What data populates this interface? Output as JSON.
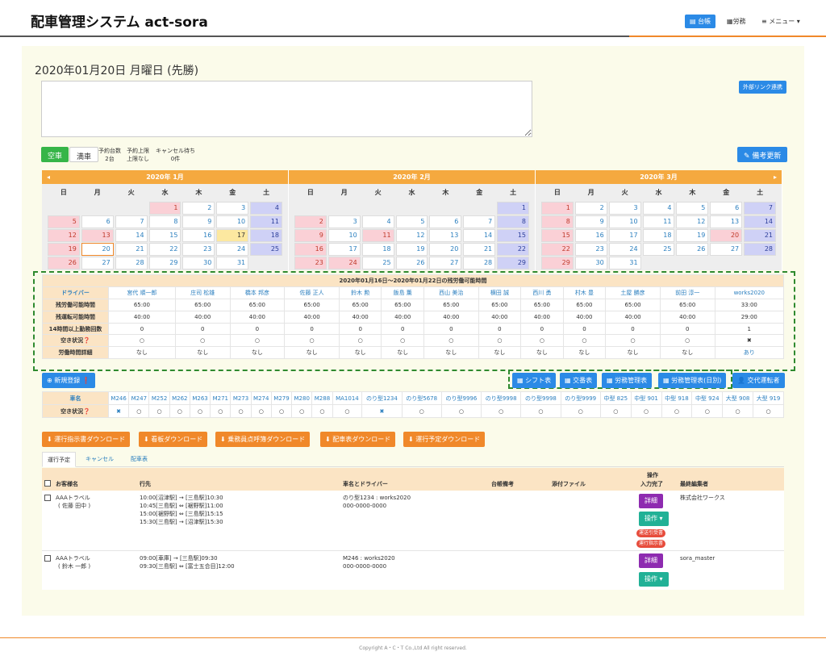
{
  "header": {
    "title": "配車管理システム act-sora",
    "nav": [
      "台帳",
      "労務",
      "≡ メニュー ▾"
    ]
  },
  "page": {
    "date_title": "2020年01月20日 月曜日 (先勝)",
    "external_link_btn": "外部リンク連携",
    "memo_value": ""
  },
  "status": {
    "empty_label": "空車",
    "full_label": "満車",
    "booking_count_label": "予約台数",
    "booking_count": "2台",
    "booking_limit_label": "予約上限",
    "booking_limit": "上限なし",
    "cancel_wait_label": "キャンセル待ち",
    "cancel_wait": "0件",
    "note_update_btn": "✎ 備考更新"
  },
  "calendar": {
    "weekdays": [
      "日",
      "月",
      "火",
      "水",
      "木",
      "金",
      "土"
    ],
    "months": [
      {
        "title": "2020年 1月",
        "weeks": [
          [
            {
              "d": ""
            },
            {
              "d": ""
            },
            {
              "d": ""
            },
            {
              "d": "1",
              "t": "hol"
            },
            {
              "d": "2"
            },
            {
              "d": "3"
            },
            {
              "d": "4",
              "t": "sat"
            }
          ],
          [
            {
              "d": "5",
              "t": "sun"
            },
            {
              "d": "6"
            },
            {
              "d": "7"
            },
            {
              "d": "8"
            },
            {
              "d": "9"
            },
            {
              "d": "10"
            },
            {
              "d": "11",
              "t": "sat"
            }
          ],
          [
            {
              "d": "12",
              "t": "sun"
            },
            {
              "d": "13",
              "t": "hol"
            },
            {
              "d": "14"
            },
            {
              "d": "15"
            },
            {
              "d": "16"
            },
            {
              "d": "17",
              "t": "yellow"
            },
            {
              "d": "18",
              "t": "sat"
            }
          ],
          [
            {
              "d": "19",
              "t": "sun"
            },
            {
              "d": "20",
              "t": "today"
            },
            {
              "d": "21"
            },
            {
              "d": "22"
            },
            {
              "d": "23"
            },
            {
              "d": "24"
            },
            {
              "d": "25",
              "t": "sat"
            }
          ],
          [
            {
              "d": "26",
              "t": "sun"
            },
            {
              "d": "27"
            },
            {
              "d": "28"
            },
            {
              "d": "29"
            },
            {
              "d": "30"
            },
            {
              "d": "31"
            },
            {
              "d": ""
            }
          ]
        ]
      },
      {
        "title": "2020年 2月",
        "weeks": [
          [
            {
              "d": ""
            },
            {
              "d": ""
            },
            {
              "d": ""
            },
            {
              "d": ""
            },
            {
              "d": ""
            },
            {
              "d": ""
            },
            {
              "d": "1",
              "t": "sat"
            }
          ],
          [
            {
              "d": "2",
              "t": "sun"
            },
            {
              "d": "3"
            },
            {
              "d": "4"
            },
            {
              "d": "5"
            },
            {
              "d": "6"
            },
            {
              "d": "7"
            },
            {
              "d": "8",
              "t": "sat"
            }
          ],
          [
            {
              "d": "9",
              "t": "sun"
            },
            {
              "d": "10"
            },
            {
              "d": "11",
              "t": "hol"
            },
            {
              "d": "12"
            },
            {
              "d": "13"
            },
            {
              "d": "14"
            },
            {
              "d": "15",
              "t": "sat"
            }
          ],
          [
            {
              "d": "16",
              "t": "sun"
            },
            {
              "d": "17"
            },
            {
              "d": "18"
            },
            {
              "d": "19"
            },
            {
              "d": "20"
            },
            {
              "d": "21"
            },
            {
              "d": "22",
              "t": "sat"
            }
          ],
          [
            {
              "d": "23",
              "t": "sun"
            },
            {
              "d": "24",
              "t": "hol"
            },
            {
              "d": "25"
            },
            {
              "d": "26"
            },
            {
              "d": "27"
            },
            {
              "d": "28"
            },
            {
              "d": "29",
              "t": "sat"
            }
          ]
        ]
      },
      {
        "title": "2020年 3月",
        "weeks": [
          [
            {
              "d": "1",
              "t": "sun"
            },
            {
              "d": "2"
            },
            {
              "d": "3"
            },
            {
              "d": "4"
            },
            {
              "d": "5"
            },
            {
              "d": "6"
            },
            {
              "d": "7",
              "t": "sat"
            }
          ],
          [
            {
              "d": "8",
              "t": "sun"
            },
            {
              "d": "9"
            },
            {
              "d": "10"
            },
            {
              "d": "11"
            },
            {
              "d": "12"
            },
            {
              "d": "13"
            },
            {
              "d": "14",
              "t": "sat"
            }
          ],
          [
            {
              "d": "15",
              "t": "sun"
            },
            {
              "d": "16"
            },
            {
              "d": "17"
            },
            {
              "d": "18"
            },
            {
              "d": "19"
            },
            {
              "d": "20",
              "t": "hol"
            },
            {
              "d": "21",
              "t": "sat"
            }
          ],
          [
            {
              "d": "22",
              "t": "sun"
            },
            {
              "d": "23"
            },
            {
              "d": "24"
            },
            {
              "d": "25"
            },
            {
              "d": "26"
            },
            {
              "d": "27"
            },
            {
              "d": "28",
              "t": "sat"
            }
          ],
          [
            {
              "d": "29",
              "t": "sun"
            },
            {
              "d": "30"
            },
            {
              "d": "31"
            },
            {
              "d": ""
            },
            {
              "d": ""
            },
            {
              "d": ""
            },
            {
              "d": ""
            }
          ]
        ]
      }
    ]
  },
  "labor": {
    "caption": "2020年01月16日～2020年01月22日の残労働可能時間",
    "row_labels": [
      "ドライバー",
      "残労働可能時間",
      "残運転可能時間",
      "14時間以上勤務回数",
      "空き状況❓",
      "労働時間詳細"
    ],
    "drivers": [
      {
        "name": "宮代 順一郎",
        "work": "65:00",
        "drive": "40:00",
        "count": "0",
        "avail": "○",
        "detail": "なし"
      },
      {
        "name": "庄司 松雄",
        "work": "65:00",
        "drive": "40:00",
        "count": "0",
        "avail": "○",
        "detail": "なし"
      },
      {
        "name": "橋本 邦彦",
        "work": "65:00",
        "drive": "40:00",
        "count": "0",
        "avail": "○",
        "detail": "なし"
      },
      {
        "name": "佐藤 正人",
        "work": "65:00",
        "drive": "40:00",
        "count": "0",
        "avail": "○",
        "detail": "なし"
      },
      {
        "name": "鈴木 勲",
        "work": "65:00",
        "drive": "40:00",
        "count": "0",
        "avail": "○",
        "detail": "なし"
      },
      {
        "name": "飯島 薫",
        "work": "65:00",
        "drive": "40:00",
        "count": "0",
        "avail": "○",
        "detail": "なし"
      },
      {
        "name": "西山 美治",
        "work": "65:00",
        "drive": "40:00",
        "count": "0",
        "avail": "○",
        "detail": "なし"
      },
      {
        "name": "横田 誠",
        "work": "65:00",
        "drive": "40:00",
        "count": "0",
        "avail": "○",
        "detail": "なし"
      },
      {
        "name": "西川 勇",
        "work": "65:00",
        "drive": "40:00",
        "count": "0",
        "avail": "○",
        "detail": "なし"
      },
      {
        "name": "村木 豊",
        "work": "65:00",
        "drive": "40:00",
        "count": "0",
        "avail": "○",
        "detail": "なし"
      },
      {
        "name": "土屋 勝彦",
        "work": "65:00",
        "drive": "40:00",
        "count": "0",
        "avail": "○",
        "detail": "なし"
      },
      {
        "name": "前田 淳一",
        "work": "65:00",
        "drive": "40:00",
        "count": "0",
        "avail": "○",
        "detail": "なし"
      },
      {
        "name": "works2020",
        "work": "33:00",
        "drive": "29:00",
        "count": "1",
        "avail": "✖",
        "detail": "あり"
      }
    ]
  },
  "toolbar": {
    "new_btn": "⊕ 新規登録 ❗",
    "shift_btn": "▦ シフト表",
    "relay_btn": "▦ 交番表",
    "labor_btn": "▦ 労務管理表",
    "labor_daily_btn": "▦ 労務管理表(日別)",
    "substitute_btn": "👤 交代運転者"
  },
  "vehicles": {
    "label_name": "車名",
    "label_avail": "空き状況❓",
    "items": [
      {
        "n": "M246",
        "a": "✖"
      },
      {
        "n": "M247",
        "a": "○"
      },
      {
        "n": "M252",
        "a": "○"
      },
      {
        "n": "M262",
        "a": "○"
      },
      {
        "n": "M263",
        "a": "○"
      },
      {
        "n": "M271",
        "a": "○"
      },
      {
        "n": "M273",
        "a": "○"
      },
      {
        "n": "M274",
        "a": "○"
      },
      {
        "n": "M279",
        "a": "○"
      },
      {
        "n": "M280",
        "a": "○"
      },
      {
        "n": "M288",
        "a": "○"
      },
      {
        "n": "MA1014",
        "a": "○"
      },
      {
        "n": "のり型1234",
        "a": "✖"
      },
      {
        "n": "のり型5678",
        "a": "○"
      },
      {
        "n": "のり型9996",
        "a": "○"
      },
      {
        "n": "のり型9998",
        "a": "○"
      },
      {
        "n": "のり型9998",
        "a": "○"
      },
      {
        "n": "のり型9999",
        "a": "○"
      },
      {
        "n": "中型 825",
        "a": "○"
      },
      {
        "n": "中型 901",
        "a": "○"
      },
      {
        "n": "中型 918",
        "a": "○"
      },
      {
        "n": "中型 924",
        "a": "○"
      },
      {
        "n": "大型 908",
        "a": "○"
      },
      {
        "n": "大型 919",
        "a": "○"
      }
    ]
  },
  "downloads": [
    "⬇ 運行指示書ダウンロード",
    "⬇ 看板ダウンロード",
    "⬇ 乗務員点呼簿ダウンロード",
    "⬇ 配車表ダウンロード",
    "⬇ 運行予定ダウンロード"
  ],
  "tabs": [
    "運行予定",
    "キャンセル",
    "配車表"
  ],
  "orders": {
    "headers": {
      "customer": "お客様名",
      "route": "行先",
      "vehicle_driver": "車名とドライバー",
      "ledger_note": "台帳備考",
      "attachment": "添付ファイル",
      "operation": "操作",
      "input_done": "入力完了",
      "last_editor": "最終編集者"
    },
    "rows": [
      {
        "customer": "AAAトラベル",
        "contact": "( 佐藤 田中 )",
        "route": [
          "10:00[沼津駅] → [三島駅]10:30",
          "10:45[三島駅] ⇔ [裾野駅]11:00",
          "15:00[裾野駅] ⇔ [三島駅]15:15",
          "15:30[三島駅] → [沼津駅]15:30"
        ],
        "vehicle": "のり型1234 : works2020",
        "phone": "000-0000-0000",
        "editor": "株式会社ワークス",
        "detail_btn": "詳細",
        "op_btn": "操作 ▾",
        "badges": [
          "運送引受書",
          "運行指示書"
        ]
      },
      {
        "customer": "AAAトラベル",
        "contact": "( 鈴木 一郎 )",
        "route": [
          "09:00[車庫] → [三島駅]09:30",
          "09:30[三島駅] ⇔ [富士五合目]12:00"
        ],
        "vehicle": "M246 : works2020",
        "phone": "000-0000-0000",
        "editor": "sora_master",
        "detail_btn": "詳細",
        "op_btn": "操作 ▾",
        "badges": []
      }
    ]
  },
  "footer": "Copyright A・C・T Co.,Ltd All right reserved."
}
